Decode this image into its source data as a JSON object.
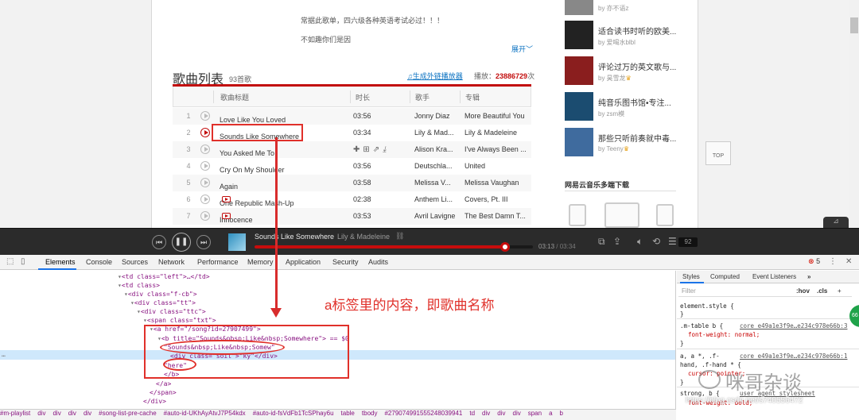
{
  "description_lines": [
    "常据此歌单，四六级各种英语考试必过！！！",
    "不如趣你们是因"
  ],
  "expand_label": "展开",
  "list": {
    "title": "歌曲列表",
    "count": "93首歌",
    "gen_link": "生成外链播放器",
    "play_label": "播放：",
    "play_count": "23886729",
    "play_unit": "次",
    "columns": [
      "歌曲标题",
      "时长",
      "歌手",
      "专辑"
    ],
    "rows": [
      {
        "num": "1",
        "title": "Love Like You Loved",
        "duration": "03:56",
        "artist": "Jonny Diaz",
        "album": "More Beautiful You",
        "mv": false
      },
      {
        "num": "2",
        "title": "Sounds Like Somewhere",
        "duration": "03:34",
        "artist": "Lily & Mad...",
        "album": "Lily & Madeleine",
        "mv": false
      },
      {
        "num": "3",
        "title": "You Asked Me To",
        "duration": "",
        "artist": "Alison Kra...",
        "album": "I've Always Been ...",
        "mv": false
      },
      {
        "num": "4",
        "title": "Cry On My Shoulder",
        "duration": "03:56",
        "artist": "Deutschla...",
        "album": "United",
        "mv": false
      },
      {
        "num": "5",
        "title": "Again",
        "duration": "03:58",
        "artist": "Melissa V...",
        "album": "Melissa Vaughan",
        "mv": false
      },
      {
        "num": "6",
        "title": "One Republic Mash-Up",
        "duration": "02:38",
        "artist": "Anthem Li...",
        "album": "Covers, Pt. III",
        "mv": true
      },
      {
        "num": "7",
        "title": "Innocence",
        "duration": "03:53",
        "artist": "Avril Lavigne",
        "album": "The Best Damn T...",
        "mv": true
      }
    ]
  },
  "sidebar": {
    "items": [
      {
        "name": "",
        "by": "亦不语z",
        "crown": false
      },
      {
        "name": "适合读书时听的欧美...",
        "by": "爱喝水blbl",
        "crown": false
      },
      {
        "name": "评论过万的英文歌与...",
        "by": "昊雪龙",
        "crown": true
      },
      {
        "name": "纯音乐图书馆•专注...",
        "by": "zsm模",
        "crown": false
      },
      {
        "name": "那些只听前奏就中毒...",
        "by": "Teeny",
        "crown": true
      }
    ],
    "by_prefix": "by",
    "download_title": "网易云音乐多端下载"
  },
  "top_label": "TOP",
  "player": {
    "song": "Sounds Like Somewhere",
    "artist": "Lily & Madeleine",
    "progress": 0.9,
    "time_current": "03:13",
    "time_total": "/ 03:34",
    "playlist_count": "92"
  },
  "devtools": {
    "tabs": [
      "Elements",
      "Console",
      "Sources",
      "Network",
      "Performance",
      "Memory",
      "Application",
      "Security",
      "Audits"
    ],
    "error_count": "5",
    "code": [
      "<td class=\"left\">…</td>",
      "<td class>",
      "<div class=\"f-cb\">",
      "<div class=\"tt\">",
      "<div class=\"ttc\">",
      "<span class=\"txt\">",
      "<a href=\"/song?id=27907499\">",
      "<b title=\"Sounds&nbsp;Like&nbsp;Somewhere\"> == $0",
      "\"Sounds&nbsp;Like&nbsp;Somew\"",
      "<div class=\"soil\">\"ky\"</div>",
      "\"here\"",
      "</b>",
      "</a>",
      "</span>",
      "</div>"
    ],
    "crumbs": [
      "#m-playlist",
      "div",
      "div",
      "div",
      "div",
      "#song-list-pre-cache",
      "#auto-id-UKhAyAtvJ7P54kdx",
      "#auto-id-fsVdFb1TcSPhay6u",
      "table",
      "tbody",
      "#279074991555248039941",
      "td",
      "div",
      "div",
      "div",
      "span",
      "a",
      "b"
    ],
    "styles_tabs": [
      "Styles",
      "Computed",
      "Event Listeners"
    ],
    "filter_placeholder": "Filter",
    "hov": ":hov",
    "cls": ".cls",
    "plus": "+",
    "rules": [
      {
        "selector": "element.style {",
        "src": ""
      },
      {
        "selector": "}",
        "src": ""
      },
      {
        "selector": ".m-table b {",
        "src": "core_e49a1e3f9e…e234c978e66b:3"
      },
      {
        "selector": "font-weight: normal;",
        "src": ""
      },
      {
        "selector": "}",
        "src": ""
      },
      {
        "selector": "a, a *, .f-",
        "src": "core_e49a1e3f9e…e234c978e66b:1"
      },
      {
        "selector": "hand, .f-hand * {",
        "src": ""
      },
      {
        "selector": "cursor: pointer;",
        "src": ""
      },
      {
        "selector": "}",
        "src": ""
      },
      {
        "selector": "strong, b {",
        "src": "user agent stylesheet"
      },
      {
        "selector": "font-weight: bold;",
        "src": ""
      }
    ],
    "green_badge": "66"
  },
  "annotation": "a标签里的内容，即歌曲名称",
  "watermark": "咪哥杂谈",
  "watermark_url": "https://blog.csdn.net/s740556472"
}
